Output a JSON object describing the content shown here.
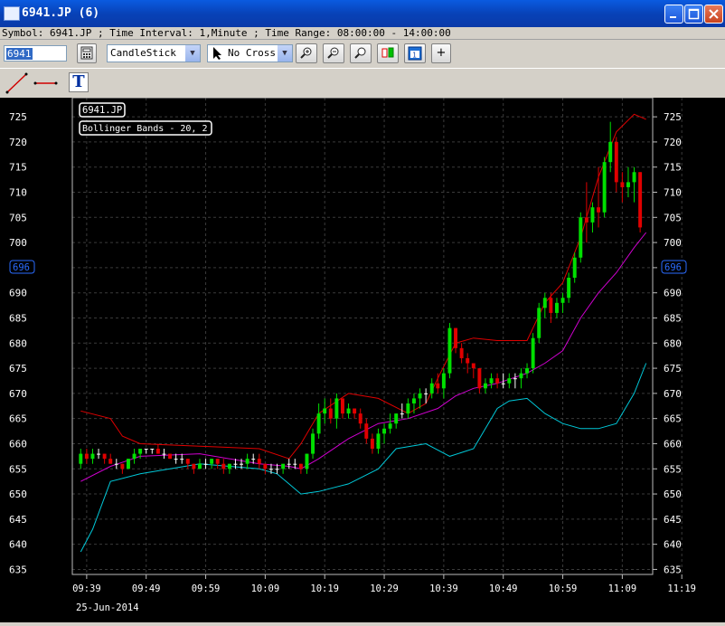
{
  "window": {
    "title": "6941.JP (6)"
  },
  "info": {
    "text": "Symbol: 6941.JP ; Time Interval: 1,Minute ; Time Range: 08:00:00 - 14:00:00"
  },
  "toolbar": {
    "symbol_value": "6941",
    "chart_type": "CandleStick",
    "cursor_mode": "No Cross",
    "plus_label": "+"
  },
  "drawbar": {
    "text_tool_label": "T"
  },
  "chart": {
    "symbol_label": "6941.JP",
    "indicator_label": "Bollinger Bands - 20, 2",
    "price_marker": "696",
    "date_label": "25-Jun-2014",
    "colors": {
      "up": "#00e000",
      "down": "#e00000",
      "upper_band": "#e00000",
      "middle_band": "#d000d0",
      "lower_band": "#00c8d8",
      "grid": "#3a3a3a"
    }
  },
  "chart_data": {
    "type": "candlestick",
    "y_ticks": [
      635,
      640,
      645,
      650,
      655,
      660,
      665,
      670,
      675,
      680,
      685,
      690,
      695,
      700,
      705,
      710,
      715,
      720,
      725
    ],
    "ylim": [
      634,
      727
    ],
    "x_ticks": [
      "09:39",
      "09:49",
      "09:59",
      "10:09",
      "10:19",
      "10:29",
      "10:39",
      "10:49",
      "10:59",
      "11:09",
      "11:19"
    ],
    "candles": [
      [
        656,
        659,
        655,
        658
      ],
      [
        658,
        659,
        656,
        657
      ],
      [
        657,
        659,
        656,
        658
      ],
      [
        658,
        659,
        657,
        658
      ],
      [
        658,
        658,
        656,
        657
      ],
      [
        657,
        658,
        656,
        656
      ],
      [
        656,
        657,
        655,
        656
      ],
      [
        656,
        656,
        654,
        655
      ],
      [
        655,
        657,
        655,
        657
      ],
      [
        657,
        659,
        656,
        658
      ],
      [
        658,
        659,
        657,
        659
      ],
      [
        659,
        659,
        658,
        659
      ],
      [
        659,
        659,
        658,
        659
      ],
      [
        659,
        660,
        658,
        658
      ],
      [
        658,
        659,
        657,
        658
      ],
      [
        658,
        658,
        657,
        657
      ],
      [
        657,
        658,
        656,
        657
      ],
      [
        657,
        658,
        656,
        657
      ],
      [
        657,
        657,
        655,
        656
      ],
      [
        656,
        656,
        654,
        655
      ],
      [
        655,
        657,
        655,
        656
      ],
      [
        656,
        657,
        655,
        656
      ],
      [
        656,
        657,
        655,
        657
      ],
      [
        657,
        657,
        655,
        656
      ],
      [
        656,
        657,
        654,
        655
      ],
      [
        655,
        656,
        654,
        656
      ],
      [
        656,
        657,
        655,
        656
      ],
      [
        656,
        657,
        655,
        656
      ],
      [
        656,
        658,
        655,
        657
      ],
      [
        657,
        658,
        656,
        657
      ],
      [
        657,
        658,
        655,
        656
      ],
      [
        656,
        656,
        654,
        655
      ],
      [
        655,
        656,
        654,
        655
      ],
      [
        655,
        656,
        654,
        655
      ],
      [
        655,
        656,
        654,
        656
      ],
      [
        656,
        657,
        655,
        656
      ],
      [
        656,
        657,
        655,
        656
      ],
      [
        656,
        656,
        654,
        655
      ],
      [
        655,
        658,
        654,
        658
      ],
      [
        658,
        663,
        657,
        662
      ],
      [
        662,
        668,
        661,
        666
      ],
      [
        666,
        669,
        664,
        667
      ],
      [
        667,
        669,
        664,
        665
      ],
      [
        665,
        670,
        663,
        669
      ],
      [
        669,
        669,
        665,
        666
      ],
      [
        666,
        668,
        665,
        667
      ],
      [
        667,
        667,
        665,
        666
      ],
      [
        666,
        667,
        663,
        664
      ],
      [
        664,
        665,
        660,
        661
      ],
      [
        661,
        662,
        658,
        659
      ],
      [
        659,
        663,
        658,
        662
      ],
      [
        662,
        664,
        660,
        663
      ],
      [
        663,
        666,
        662,
        664
      ],
      [
        664,
        666,
        663,
        666
      ],
      [
        666,
        668,
        665,
        666
      ],
      [
        666,
        669,
        665,
        668
      ],
      [
        668,
        670,
        666,
        669
      ],
      [
        669,
        671,
        667,
        670
      ],
      [
        670,
        671,
        668,
        670
      ],
      [
        670,
        673,
        669,
        672
      ],
      [
        672,
        674,
        670,
        671
      ],
      [
        671,
        675,
        669,
        674
      ],
      [
        674,
        684,
        673,
        683
      ],
      [
        683,
        683,
        678,
        679
      ],
      [
        679,
        680,
        676,
        677
      ],
      [
        677,
        678,
        674,
        676
      ],
      [
        676,
        676,
        673,
        675
      ],
      [
        675,
        674,
        670,
        671
      ],
      [
        671,
        673,
        670,
        672
      ],
      [
        672,
        674,
        671,
        673
      ],
      [
        673,
        674,
        671,
        672
      ],
      [
        672,
        674,
        671,
        672
      ],
      [
        672,
        674,
        671,
        673
      ],
      [
        673,
        674,
        671,
        673
      ],
      [
        673,
        675,
        671,
        674
      ],
      [
        674,
        676,
        673,
        675
      ],
      [
        675,
        682,
        674,
        681
      ],
      [
        681,
        688,
        680,
        687
      ],
      [
        687,
        690,
        685,
        689
      ],
      [
        689,
        690,
        684,
        686
      ],
      [
        686,
        689,
        685,
        688
      ],
      [
        688,
        690,
        686,
        689
      ],
      [
        689,
        694,
        688,
        693
      ],
      [
        693,
        698,
        692,
        697
      ],
      [
        697,
        706,
        696,
        705
      ],
      [
        705,
        712,
        700,
        704
      ],
      [
        704,
        708,
        702,
        707
      ],
      [
        707,
        715,
        703,
        706
      ],
      [
        706,
        717,
        705,
        716
      ],
      [
        716,
        724,
        714,
        720
      ],
      [
        720,
        721,
        710,
        712
      ],
      [
        712,
        714,
        708,
        711
      ],
      [
        711,
        715,
        709,
        712
      ],
      [
        712,
        715,
        708,
        714
      ],
      [
        714,
        714,
        702,
        703
      ]
    ],
    "upper_band": [
      [
        0,
        666.5
      ],
      [
        5,
        665
      ],
      [
        7,
        661.5
      ],
      [
        10,
        660
      ],
      [
        20,
        659.5
      ],
      [
        30,
        659
      ],
      [
        35,
        657
      ],
      [
        37,
        660
      ],
      [
        40,
        666
      ],
      [
        45,
        670
      ],
      [
        50,
        669
      ],
      [
        55,
        666
      ],
      [
        58,
        668
      ],
      [
        60,
        673
      ],
      [
        63,
        680
      ],
      [
        66,
        681
      ],
      [
        70,
        680.5
      ],
      [
        75,
        680.5
      ],
      [
        78,
        688
      ],
      [
        81,
        692
      ],
      [
        84,
        701
      ],
      [
        87,
        713
      ],
      [
        90,
        722
      ],
      [
        93,
        725.5
      ],
      [
        95,
        724.5
      ]
    ],
    "middle_band": [
      [
        0,
        652.5
      ],
      [
        5,
        655.5
      ],
      [
        10,
        657.5
      ],
      [
        20,
        658
      ],
      [
        30,
        656
      ],
      [
        35,
        655.5
      ],
      [
        37,
        655
      ],
      [
        40,
        657
      ],
      [
        45,
        661
      ],
      [
        50,
        664
      ],
      [
        55,
        665
      ],
      [
        60,
        667
      ],
      [
        63,
        669.5
      ],
      [
        66,
        671
      ],
      [
        70,
        672
      ],
      [
        75,
        674
      ],
      [
        78,
        676
      ],
      [
        81,
        678.5
      ],
      [
        84,
        685
      ],
      [
        87,
        690
      ],
      [
        90,
        694
      ],
      [
        93,
        699
      ],
      [
        95,
        702
      ]
    ],
    "lower_band": [
      [
        0,
        638.5
      ],
      [
        2,
        643
      ],
      [
        5,
        652.5
      ],
      [
        10,
        654
      ],
      [
        15,
        655
      ],
      [
        20,
        656
      ],
      [
        30,
        655
      ],
      [
        33,
        654
      ],
      [
        35,
        652
      ],
      [
        37,
        650
      ],
      [
        40,
        650.5
      ],
      [
        45,
        652
      ],
      [
        50,
        655
      ],
      [
        53,
        659
      ],
      [
        58,
        660
      ],
      [
        62,
        657.5
      ],
      [
        66,
        659
      ],
      [
        70,
        667
      ],
      [
        72,
        668.5
      ],
      [
        75,
        669
      ],
      [
        78,
        666
      ],
      [
        81,
        664
      ],
      [
        84,
        663
      ],
      [
        87,
        663
      ],
      [
        90,
        664
      ],
      [
        93,
        670
      ],
      [
        95,
        676
      ]
    ]
  }
}
